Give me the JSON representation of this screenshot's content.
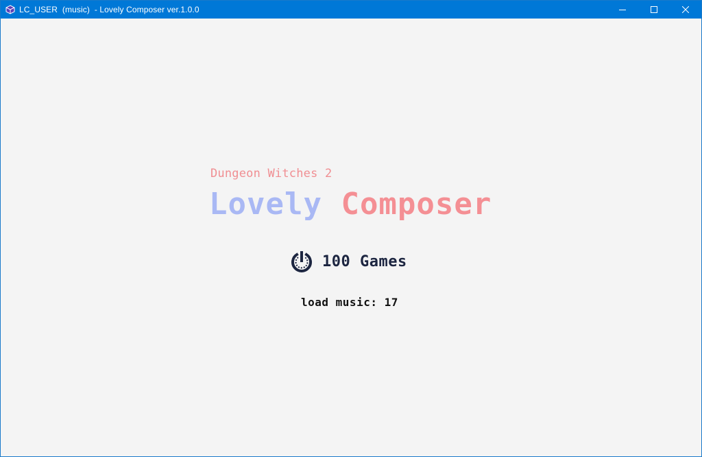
{
  "window": {
    "title": "LC_USER  (music)  - Lovely Composer ver.1.0.0",
    "controls": {
      "minimize": "minimize-icon",
      "maximize": "maximize-icon",
      "close": "close-icon"
    }
  },
  "splash": {
    "subtitle": "Dungeon Witches 2",
    "title_part1": "Lovely",
    "title_part2": "Composer",
    "brand": "100 Games",
    "status": "load music: 17"
  },
  "colors": {
    "titlebar": "#0078d7",
    "background": "#f4f4f4",
    "lovely": "#a9b8f4",
    "composer": "#f48f94",
    "subtitle": "#f08e92",
    "brand": "#1c2540",
    "status": "#111111"
  }
}
